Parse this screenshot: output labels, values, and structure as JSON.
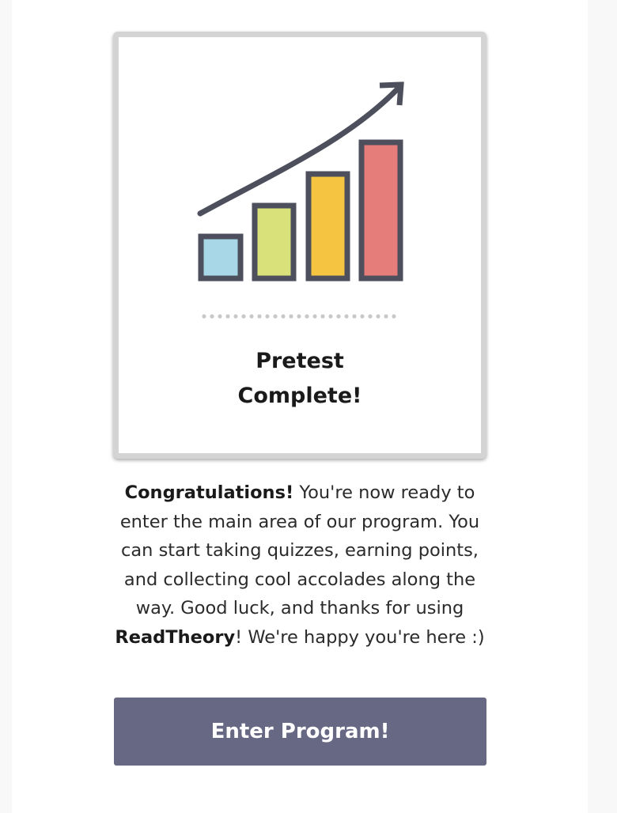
{
  "card": {
    "title_line1": "Pretest",
    "title_line2": "Complete!",
    "illustration": "growth-bar-chart-with-arrow-icon",
    "colors": {
      "outline": "#4d4f5c",
      "bar1": "#a8d8e8",
      "bar2": "#d9e27a",
      "bar3": "#f5c542",
      "bar4": "#e57d7a",
      "dots": "#c8c8c8",
      "border": "#d4d4d4"
    }
  },
  "message": {
    "lead": "Congratulations!",
    "body1": " You're now ready to enter the main area of our program. You can start taking quizzes, earning points, and collecting cool accolades along the way. Good luck, and thanks for using ",
    "brand": "ReadTheory",
    "body2": "! We're happy you're here :)"
  },
  "button": {
    "label": "Enter Program!",
    "color": "#676883"
  }
}
